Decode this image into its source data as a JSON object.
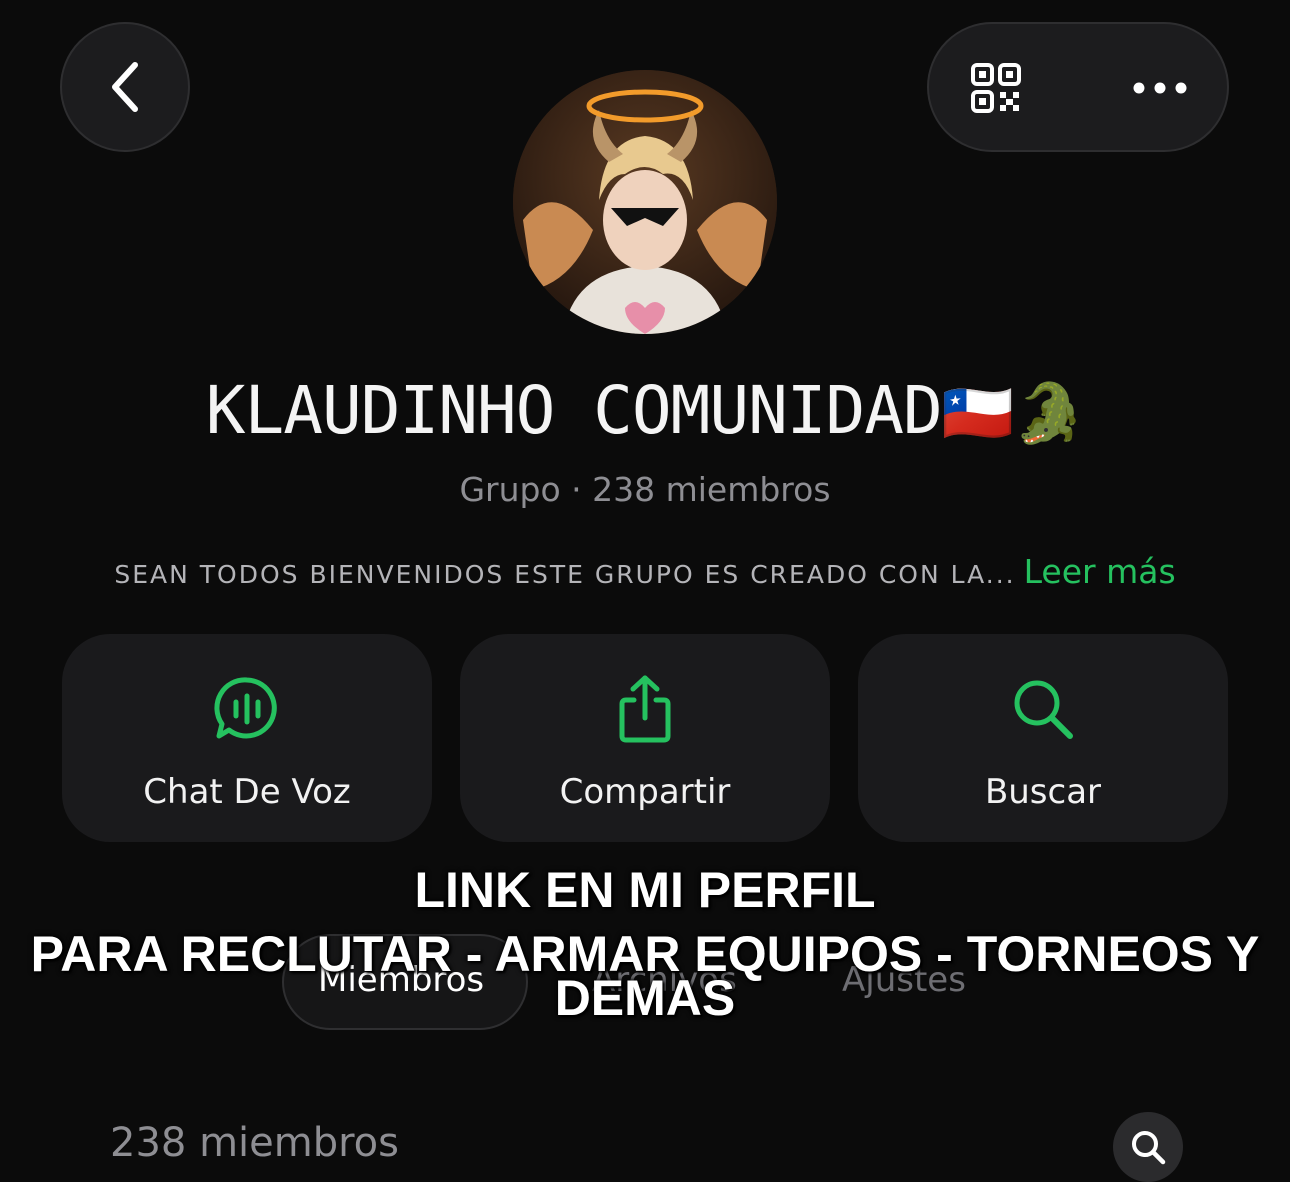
{
  "header": {
    "back_icon": "chevron-left-icon",
    "qr_icon": "qr-code-icon",
    "more_icon": "more-horizontal-icon"
  },
  "group": {
    "name": "KLAUDINHO COMUNIDAD",
    "name_emojis": "🇨🇱🐊",
    "subtitle": "Grupo · 238 miembros",
    "description": "SEAN TODOS BIENVENIDOS ESTE GRUPO ES CREADO CON LA...",
    "read_more": "Leer más"
  },
  "actions": [
    {
      "label": "Chat De Voz",
      "icon": "voice-chat-icon"
    },
    {
      "label": "Compartir",
      "icon": "share-icon"
    },
    {
      "label": "Buscar",
      "icon": "search-icon"
    }
  ],
  "tabs": [
    {
      "label": "Miembros",
      "selected": true
    },
    {
      "label": "Archivos",
      "selected": false
    },
    {
      "label": "Ajustes",
      "selected": false
    }
  ],
  "overlay": {
    "line1": "LINK EN MI PERFIL",
    "line2": "PARA RECLUTAR - ARMAR EQUIPOS - TORNEOS Y",
    "line3": "DEMAS"
  },
  "members": {
    "count_label": "238 miembros",
    "search_icon": "search-icon"
  },
  "colors": {
    "background": "#0b0b0b",
    "accent": "#25c15f",
    "card": "#1a1a1c",
    "muted_text": "#8e8e93"
  }
}
